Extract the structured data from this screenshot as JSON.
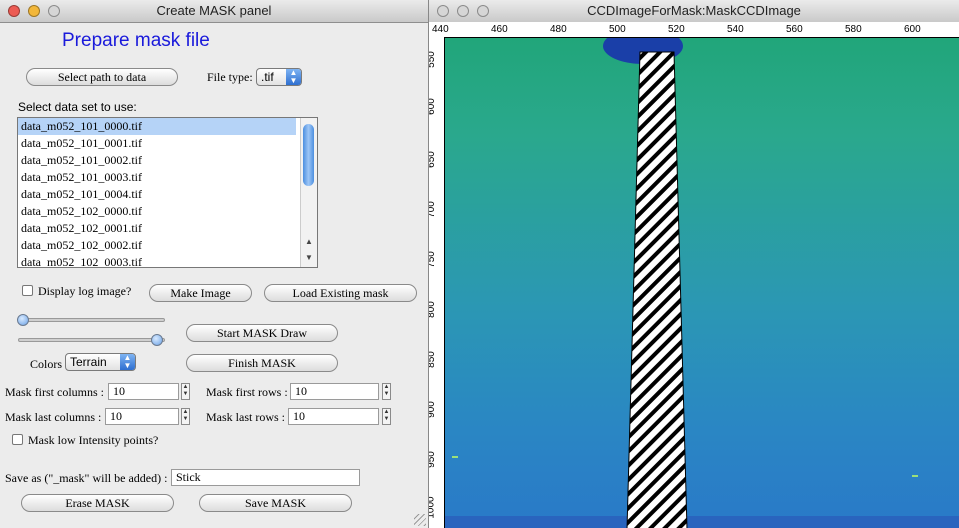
{
  "panel": {
    "title": "Create MASK panel",
    "heading": "Prepare mask file",
    "select_path_label": "Select path to data",
    "file_type_label": "File type:",
    "file_type_value": ".tif",
    "select_data_label": "Select data set to use:",
    "files": [
      "data_m052_101_0000.tif",
      "data_m052_101_0001.tif",
      "data_m052_101_0002.tif",
      "data_m052_101_0003.tif",
      "data_m052_101_0004.tif",
      "data_m052_102_0000.tif",
      "data_m052_102_0001.tif",
      "data_m052_102_0002.tif",
      "data_m052_102_0003.tif"
    ],
    "display_log_label": "Display log image?",
    "make_image_label": "Make Image",
    "load_mask_label": "Load Existing mask",
    "start_draw_label": "Start MASK Draw",
    "finish_mask_label": "Finish MASK",
    "colors_label": "Colors",
    "colors_value": "Terrain",
    "mask_first_columns_label": "Mask first columns :",
    "mask_first_columns_value": "10",
    "mask_last_columns_label": "Mask last columns :",
    "mask_last_columns_value": "10",
    "mask_first_rows_label": "Mask first rows :",
    "mask_first_rows_value": "10",
    "mask_last_rows_label": "Mask last rows :",
    "mask_last_rows_value": "10",
    "mask_low_label": "Mask low Intensity points?",
    "save_as_label": "Save as (\"_mask\" will be added) :",
    "save_as_value": "Stick",
    "erase_label": "Erase MASK",
    "save_label": "Save MASK"
  },
  "image_window": {
    "title": "CCDImageForMask:MaskCCDImage",
    "x_ticks": [
      "440",
      "460",
      "480",
      "500",
      "520",
      "540",
      "560",
      "580",
      "600"
    ],
    "y_ticks": [
      "550",
      "600",
      "650",
      "700",
      "750",
      "800",
      "850",
      "900",
      "950",
      "1000"
    ]
  }
}
